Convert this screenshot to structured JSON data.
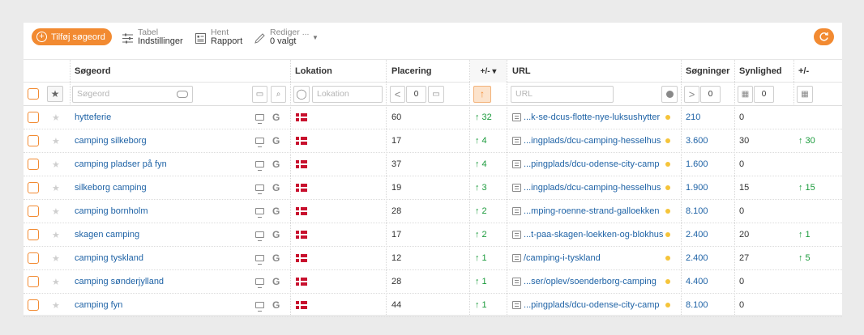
{
  "toolbar": {
    "add_label": "Tilføj søgeord",
    "table_settings": {
      "line1": "Tabel",
      "line2": "Indstillinger"
    },
    "get_report": {
      "line1": "Hent",
      "line2": "Rapport"
    },
    "edit": {
      "line1": "Rediger ...",
      "line2": "0 valgt"
    }
  },
  "columns": {
    "keyword": "Søgeord",
    "location": "Lokation",
    "position": "Placering",
    "change": "+/- ▾",
    "url": "URL",
    "searches": "Søgninger",
    "visibility": "Synlighed",
    "vis_change": "+/-"
  },
  "filters": {
    "keyword_placeholder": "Søgeord",
    "location_placeholder": "Lokation",
    "url_placeholder": "URL",
    "position_op": "<",
    "position_value": "0",
    "searches_op": ">",
    "searches_value": "0",
    "visibility_value": "0"
  },
  "colors": {
    "accent": "#f28a31",
    "link": "#1f63a6",
    "up": "#1a9a3b",
    "flag": "#c8102e"
  },
  "rows": [
    {
      "keyword": "hytteferie",
      "position": "60",
      "change": "↑ 32",
      "url": "...k-se-dcus-flotte-nye-luksushytter",
      "searches": "210",
      "visibility": "0",
      "vis_change": ""
    },
    {
      "keyword": "camping silkeborg",
      "position": "17",
      "change": "↑ 4",
      "url": "...ingplads/dcu-camping-hesselhus",
      "searches": "3.600",
      "visibility": "30",
      "vis_change": "↑ 30"
    },
    {
      "keyword": "camping pladser på fyn",
      "position": "37",
      "change": "↑ 4",
      "url": "...pingplads/dcu-odense-city-camp",
      "searches": "1.600",
      "visibility": "0",
      "vis_change": ""
    },
    {
      "keyword": "silkeborg camping",
      "position": "19",
      "change": "↑ 3",
      "url": "...ingplads/dcu-camping-hesselhus",
      "searches": "1.900",
      "visibility": "15",
      "vis_change": "↑ 15"
    },
    {
      "keyword": "camping bornholm",
      "position": "28",
      "change": "↑ 2",
      "url": "...mping-roenne-strand-galloekken",
      "searches": "8.100",
      "visibility": "0",
      "vis_change": ""
    },
    {
      "keyword": "skagen camping",
      "position": "17",
      "change": "↑ 2",
      "url": "...t-paa-skagen-loekken-og-blokhus",
      "searches": "2.400",
      "visibility": "20",
      "vis_change": "↑ 1"
    },
    {
      "keyword": "camping tyskland",
      "position": "12",
      "change": "↑ 1",
      "url": "/camping-i-tyskland",
      "searches": "2.400",
      "visibility": "27",
      "vis_change": "↑ 5"
    },
    {
      "keyword": "camping sønderjylland",
      "position": "28",
      "change": "↑ 1",
      "url": "...ser/oplev/soenderborg-camping",
      "searches": "4.400",
      "visibility": "0",
      "vis_change": ""
    },
    {
      "keyword": "camping fyn",
      "position": "44",
      "change": "↑ 1",
      "url": "...pingplads/dcu-odense-city-camp",
      "searches": "8.100",
      "visibility": "0",
      "vis_change": ""
    }
  ]
}
